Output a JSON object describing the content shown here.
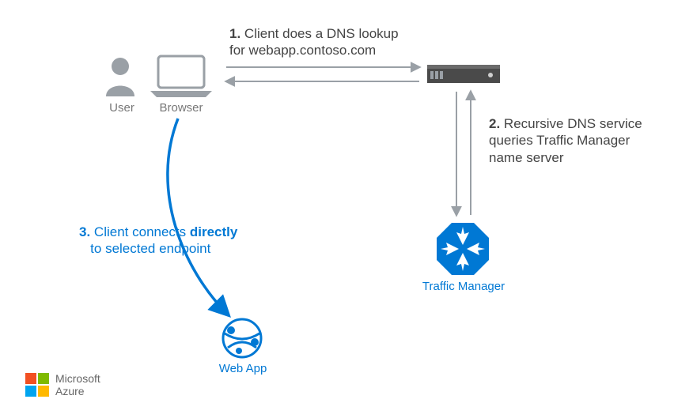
{
  "diagram": {
    "nodes": {
      "user": {
        "label": "User"
      },
      "browser": {
        "label": "Browser"
      },
      "dns_server": {
        "label": ""
      },
      "traffic_manager": {
        "label": "Traffic Manager"
      },
      "web_app": {
        "label": "Web App"
      }
    },
    "steps": {
      "step1": {
        "num": "1.",
        "text_line1": "Client does a DNS lookup",
        "text_line2": "for webapp.contoso.com"
      },
      "step2": {
        "num": "2.",
        "text_line1": "Recursive DNS service",
        "text_line2": "queries Traffic Manager",
        "text_line3": "name server"
      },
      "step3": {
        "num": "3.",
        "text_prefix": "Client connects ",
        "text_bold": "directly",
        "text_line2": "to selected endpoint"
      }
    },
    "colors": {
      "gray": "#9aa0a6",
      "azure_blue": "#0078d4",
      "text_gray": "#444444"
    }
  },
  "logo": {
    "line1": "Microsoft",
    "line2": "Azure"
  }
}
